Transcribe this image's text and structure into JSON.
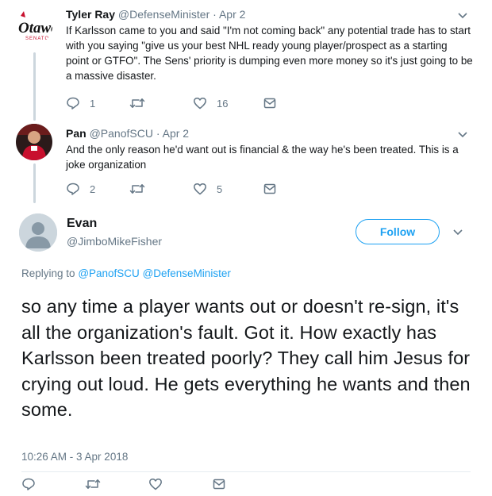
{
  "tweets": [
    {
      "name": "Tyler Ray",
      "handle": "@DefenseMinister",
      "separator": "·",
      "date": "Apr 2",
      "avatar_text": "Ottawa",
      "text": "If Karlsson came to you and said \"I'm not coming back\" any potential trade has to start with you saying \"give us your best NHL ready young player/prospect as a starting point or GTFO\". The Sens' priority is dumping even more money so it's just going to be a massive disaster.",
      "replies": "1",
      "retweets": "",
      "likes": "16"
    },
    {
      "name": "Pan",
      "handle": "@PanofSCU",
      "separator": "·",
      "date": "Apr 2",
      "text": "And the only reason he'd want out is financial & the way he's been treated.  This is a joke organization",
      "replies": "2",
      "retweets": "",
      "likes": "5"
    }
  ],
  "main": {
    "name": "Evan",
    "handle": "@JimboMikeFisher",
    "follow_label": "Follow",
    "replying_prefix": "Replying to",
    "replying_to": [
      "@PanofSCU",
      "@DefenseMinister"
    ],
    "text": "so any time a player wants out or doesn't re-sign, it's all the organization's fault. Got it. How exactly has Karlsson been treated poorly? They call him Jesus for crying out loud. He gets everything he wants and then some.",
    "timestamp": "10:26 AM - 3 Apr 2018"
  },
  "colors": {
    "accent": "#1da1f2",
    "muted": "#657786",
    "thread_line": "#ccd6dd",
    "ottawa_red": "#c8102e"
  },
  "icons": [
    "reply-icon",
    "retweet-icon",
    "like-icon",
    "message-icon",
    "chevron-down-icon"
  ]
}
